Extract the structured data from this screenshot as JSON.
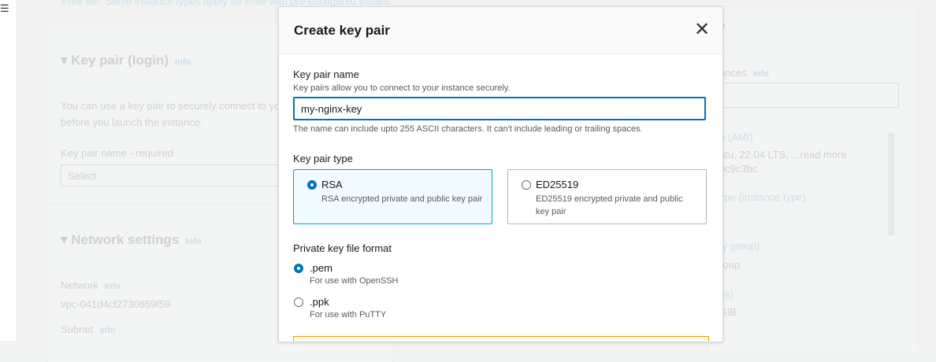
{
  "left_nav": {
    "menu_icon": "hamburger-menu-icon"
  },
  "background": {
    "top_banner": "Free tier: Some instance types apply for Free with pre-configured instances",
    "keypair_section": {
      "title": "Key pair (login)",
      "info": "Info",
      "description_line1": "You can use a key pair to securely connect to your instance. Ensure that you have access to the selected key pair",
      "description_line2": "before you launch the instance.",
      "field_label": "Key pair name - required",
      "select_placeholder": "Select"
    },
    "network_section": {
      "title": "Network settings",
      "info": "Info",
      "network_label": "Network",
      "network_info": "Info",
      "network_value": "vpc-041d4cf2730859f59",
      "subnet_label": "Subnet",
      "subnet_info": "Info"
    },
    "summary": {
      "title_fragment": "y",
      "instances_label": "ances",
      "instances_info": "Info",
      "ami_label": "e (AMI)",
      "ami_value": "ntu, 22.04 LTS, ...read more",
      "ami_id": "0c9c3bc",
      "instance_type": "ype (instance type)",
      "security_group": "ty group)",
      "group": "roup",
      "volumes": "es)",
      "size": "GiB"
    }
  },
  "modal": {
    "title": "Create key pair",
    "close_icon": "close-icon",
    "key_pair_name": {
      "label": "Key pair name",
      "description": "Key pairs allow you to connect to your instance securely.",
      "value": "my-nginx-key",
      "constraint": "The name can include upto 255 ASCII characters. It can't include leading or trailing spaces."
    },
    "key_pair_type": {
      "label": "Key pair type",
      "options": [
        {
          "title": "RSA",
          "description": "RSA encrypted private and public key pair",
          "selected": true
        },
        {
          "title": "ED25519",
          "description": "ED25519 encrypted private and public key pair",
          "selected": false
        }
      ]
    },
    "file_format": {
      "label": "Private key file format",
      "options": [
        {
          "title": ".pem",
          "description": "For use with OpenSSH",
          "selected": true
        },
        {
          "title": ".ppk",
          "description": "For use with PuTTY",
          "selected": false
        }
      ]
    }
  },
  "colors": {
    "accent": "#0073bb",
    "selected_tile_bg": "#f1faff",
    "warning_border": "#ff9900"
  }
}
